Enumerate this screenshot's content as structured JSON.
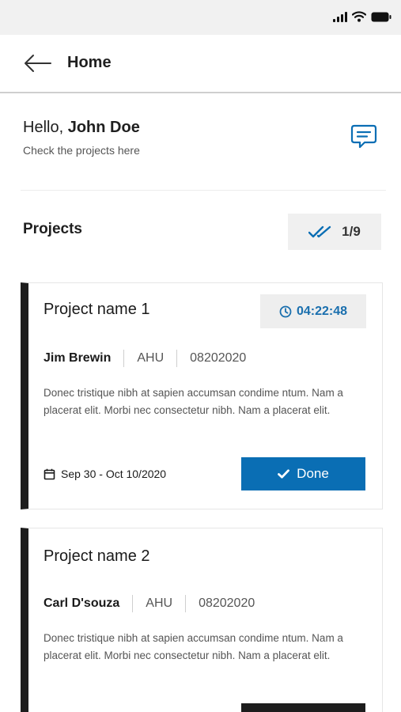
{
  "header": {
    "title": "Home"
  },
  "greeting": {
    "hello": "Hello,",
    "user_name": "John Doe",
    "subtitle": "Check the projects here"
  },
  "projects": {
    "title": "Projects",
    "count": "1/9",
    "items": [
      {
        "name": "Project name 1",
        "timer": "04:22:48",
        "person": "Jim Brewin",
        "type": "AHU",
        "code": "08202020",
        "description": "Donec tristique nibh at sapien accumsan condime ntum. Nam a placerat elit. Morbi nec consectetur nibh. Nam a placerat elit.",
        "dates": "Sep 30 - Oct 10/2020",
        "action_label": "Done"
      },
      {
        "name": "Project name 2",
        "person": "Carl D'souza",
        "type": "AHU",
        "code": "08202020",
        "description": "Donec tristique nibh at sapien accumsan condime ntum. Nam a placerat elit. Morbi nec consectetur nibh. Nam a placerat elit."
      }
    ]
  },
  "colors": {
    "accent": "#0a6eb4",
    "card_border": "#1d1d1d",
    "timer_text": "#1a6fae"
  },
  "icons": [
    "signal-icon",
    "wifi-icon",
    "battery-icon",
    "back-arrow-icon",
    "chat-icon",
    "double-check-icon",
    "clock-icon",
    "calendar-icon",
    "check-icon"
  ]
}
